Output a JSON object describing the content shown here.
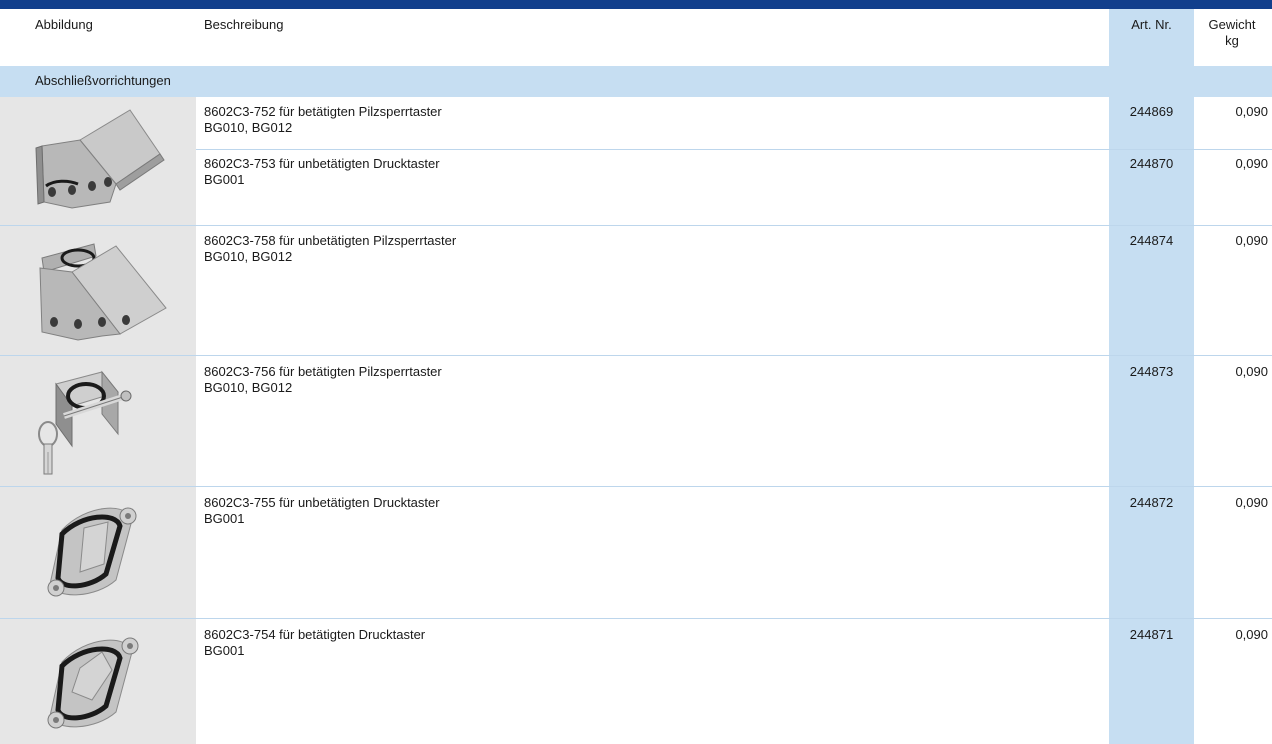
{
  "table": {
    "headers": {
      "image": "Abbildung",
      "description": "Beschreibung",
      "art_nr": "Art. Nr.",
      "weight_line1": "Gewicht",
      "weight_line2": "kg"
    },
    "section": "Abschließvorrichtungen",
    "rows": [
      {
        "desc1": "8602C3-752 für betätigten Pilzsperrtaster",
        "desc2": "BG010, BG012",
        "art": "244869",
        "weight": "0,090",
        "icon": "lockout-cover-mushroom-actuated-icon"
      },
      {
        "desc1": "8602C3-753 für unbetätigten Drucktaster",
        "desc2": "BG001",
        "art": "244870",
        "weight": "0,090",
        "icon": "lockout-cover-mushroom-actuated-icon"
      },
      {
        "desc1": "8602C3-758 für unbetätigten Pilzsperrtaster",
        "desc2": "BG010, BG012",
        "art": "244874",
        "weight": "0,090",
        "icon": "lockout-cover-mushroom-unactuated-icon"
      },
      {
        "desc1": "8602C3-756 für betätigten Pilzsperrtaster",
        "desc2": "BG010, BG012",
        "art": "244873",
        "weight": "0,090",
        "icon": "lockout-bracket-with-padlock-icon"
      },
      {
        "desc1": "8602C3-755 für unbetätigten Drucktaster",
        "desc2": "BG001",
        "art": "244872",
        "weight": "0,090",
        "icon": "lockout-clamp-ring-icon"
      },
      {
        "desc1": "8602C3-754 für betätigten Drucktaster",
        "desc2": "BG001",
        "art": "244871",
        "weight": "0,090",
        "icon": "lockout-clamp-ring-open-icon"
      }
    ]
  },
  "colors": {
    "top_bar": "#123f8c",
    "highlight": "#c6def2",
    "image_background": "#e6e6e6",
    "divider": "#bdd6ec"
  }
}
